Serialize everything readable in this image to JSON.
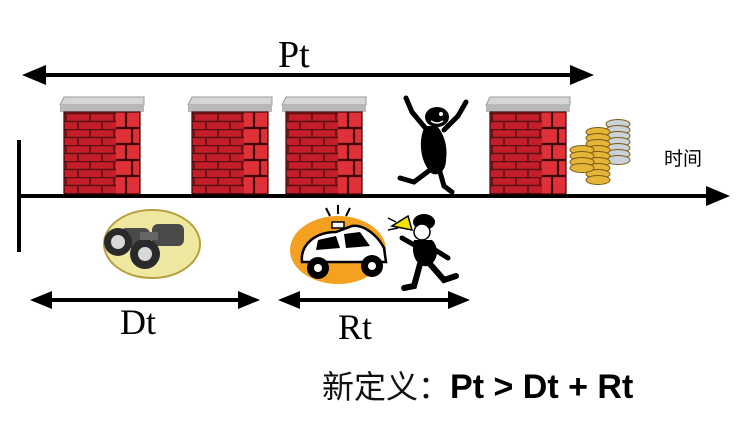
{
  "labels": {
    "protection_time": "Pt",
    "detection_time": "Dt",
    "response_time": "Rt",
    "time_axis": "时间"
  },
  "definition": {
    "prefix": "新定义：",
    "formula": "Pt > Dt + Rt"
  },
  "colors": {
    "brick": "#c41e2a",
    "brick_light": "#e03038",
    "mortar": "#5a1010",
    "wall_cap": "#d6d6d6",
    "coin_gold": "#e5b53a",
    "coin_silver": "#c9d1d9",
    "binocular_bg": "#efe8a0",
    "car_bg": "#f4a020",
    "line": "#000000"
  },
  "icons": [
    "brick-wall-icon",
    "thief-icon",
    "coins-icon",
    "binoculars-icon",
    "police-car-icon",
    "police-officer-icon"
  ]
}
